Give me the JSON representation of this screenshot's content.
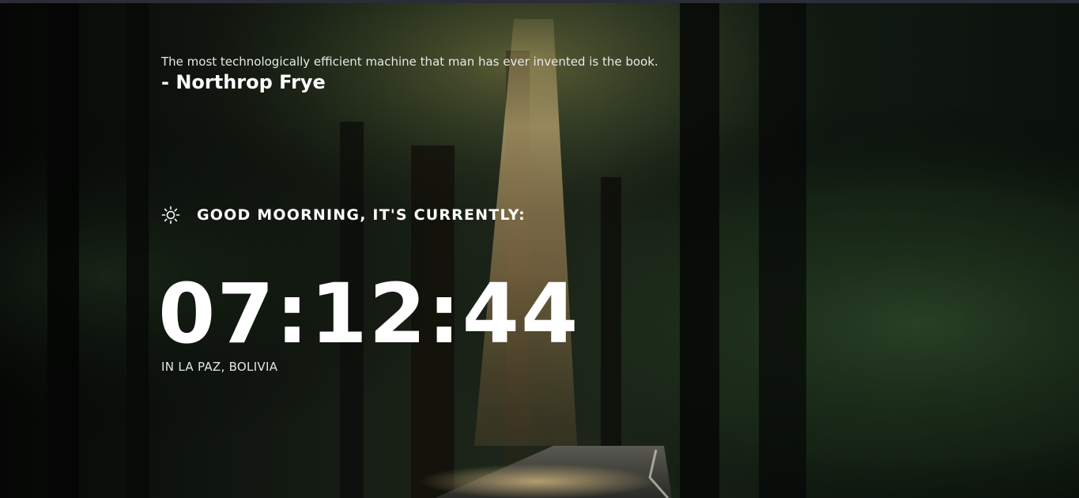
{
  "quote": {
    "text": "The most technologically efficient machine that man has ever invented is the book.",
    "author": "- Northrop Frye"
  },
  "greeting": {
    "icon": "sun-icon",
    "text": "GOOD MOORNING, IT'S CURRENTLY:"
  },
  "clock": {
    "time": "07:12:44"
  },
  "location": {
    "text": "IN LA PAZ, BOLIVIA"
  },
  "colors": {
    "text": "#ffffff",
    "top_bar": "#2a2d36",
    "light_beam": "#e7c88a"
  }
}
